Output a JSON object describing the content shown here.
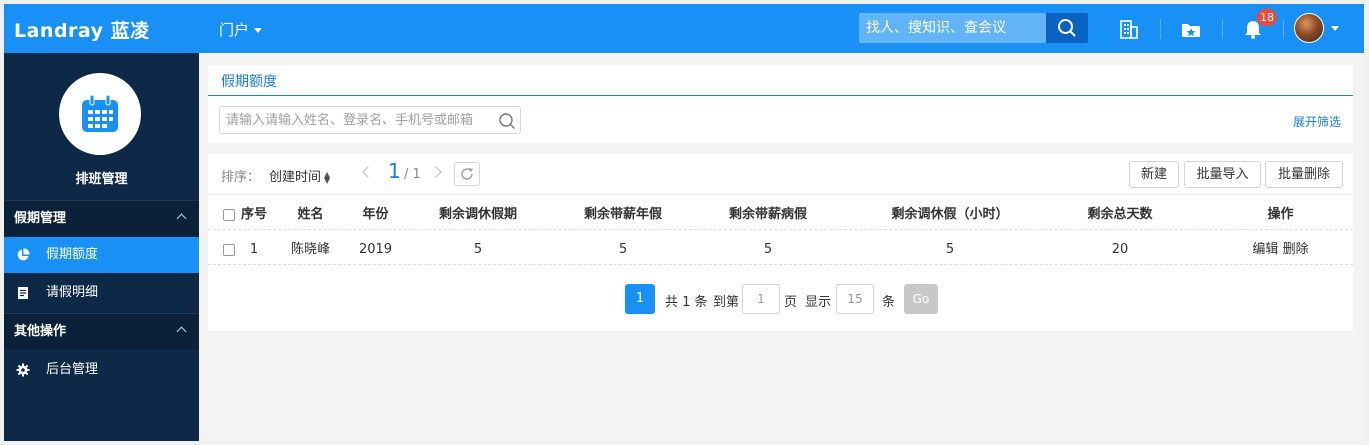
{
  "app": {
    "logo_text": "Landray 蓝凌",
    "portal_label": "门户",
    "search_placeholder": "找人、搜知识、查会议",
    "notification_count": "18"
  },
  "sidebar": {
    "module_title": "排班管理",
    "groups": [
      {
        "label": "假期管理",
        "items": [
          {
            "label": "假期额度",
            "icon": "pie-chart-icon",
            "active": true
          },
          {
            "label": "请假明细",
            "icon": "document-icon",
            "active": false
          }
        ]
      },
      {
        "label": "其他操作",
        "items": [
          {
            "label": "后台管理",
            "icon": "gear-icon",
            "active": false
          }
        ]
      }
    ]
  },
  "main": {
    "page_title": "假期额度",
    "filter_placeholder": "请输入请输入姓名、登录名、手机号或邮箱",
    "expand_filter": "展开筛选",
    "toolbar": {
      "sort_label": "排序：",
      "sort_field": "创建时间",
      "current_page": "1",
      "total_pages": "/ 1",
      "new_label": "新建",
      "import_label": "批量导入",
      "delete_label": "批量删除"
    },
    "table": {
      "columns": [
        "序号",
        "姓名",
        "年份",
        "剩余调休假期",
        "剩余带薪年假",
        "剩余带薪病假",
        "剩余调休假（小时）",
        "剩余总天数",
        "操作"
      ],
      "rows": [
        {
          "index": "1",
          "name": "陈晓峰",
          "year": "2019",
          "rest_leave": "5",
          "annual_leave": "5",
          "sick_leave": "5",
          "rest_hours": "5",
          "total_days": "20",
          "edit": "编辑",
          "delete": "删除"
        }
      ]
    },
    "pager": {
      "page": "1",
      "total_text": "共 1 条",
      "goto_label": "到第",
      "goto_value": "1",
      "page_unit": "页",
      "show_label": "显示",
      "page_size": "15",
      "size_unit": "条",
      "go_label": "Go"
    }
  },
  "colors": {
    "brand": "#1890f5",
    "sidebar_bg": "#0e2847",
    "link": "#1a7ed6"
  }
}
